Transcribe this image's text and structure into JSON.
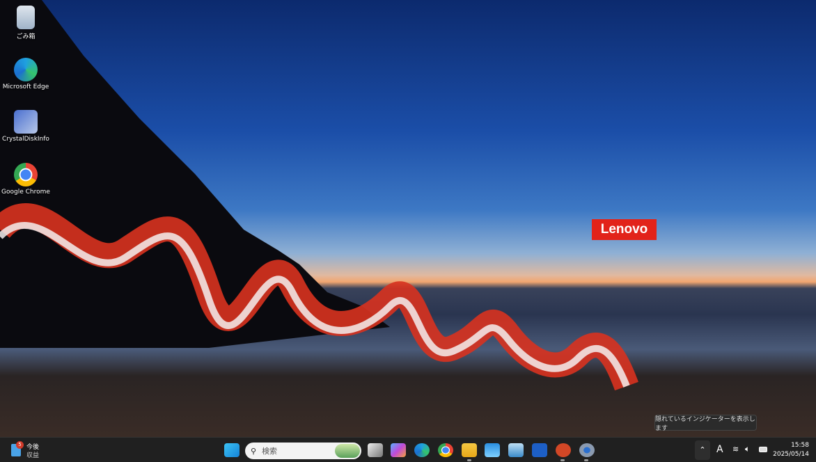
{
  "desktop": {
    "icons": [
      {
        "label": "ごみ箱"
      },
      {
        "label": "Microsoft Edge"
      },
      {
        "label": "CrystalDiskInfo"
      },
      {
        "label": "Google Chrome"
      }
    ],
    "brand": "Lenovo"
  },
  "taskbar": {
    "widget": {
      "badge": "5",
      "line1": "今後",
      "line2": "収益"
    },
    "search_placeholder": "検索",
    "apps": [
      "start-icon",
      "task-view-icon",
      "copilot-icon",
      "edge-icon",
      "chrome-icon",
      "file-explorer-icon",
      "photos-icon",
      "control-panel-icon",
      "word-icon",
      "powerpoint-icon",
      "settings-icon"
    ],
    "tray": {
      "ime": "A",
      "time": "15:58",
      "date": "2025/05/14",
      "tooltip": "隠れているインジケーターを表示します"
    }
  },
  "colors": {
    "brand": "#e2231a",
    "taskbar": "#202020"
  }
}
